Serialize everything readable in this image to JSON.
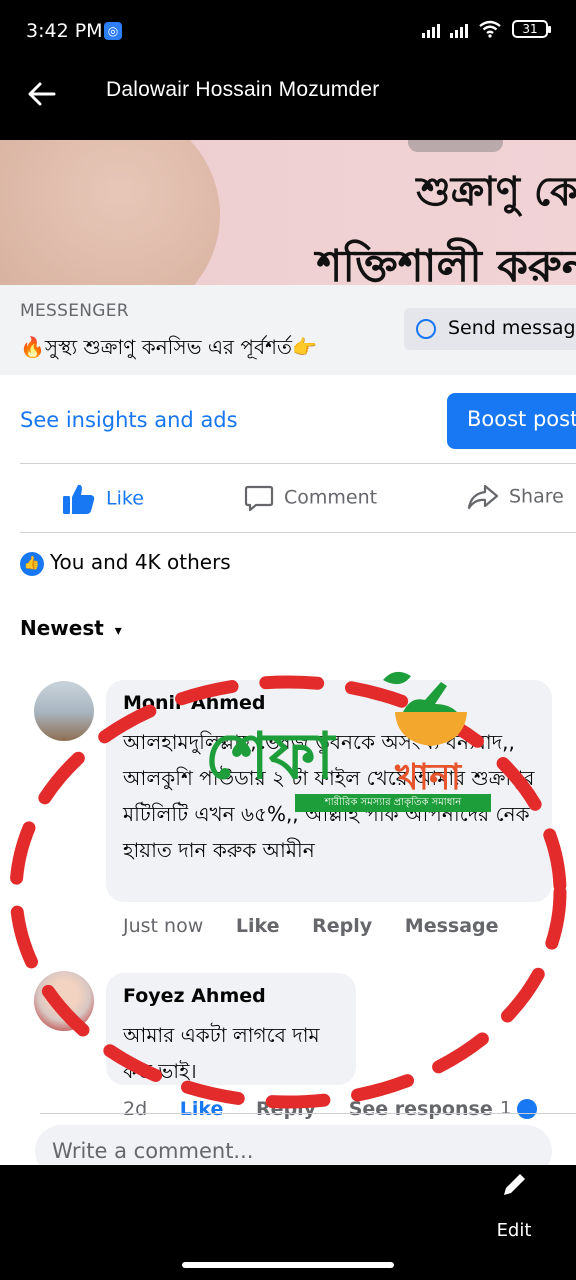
{
  "status_bar": {
    "time": "3:42 PM",
    "battery": "31"
  },
  "top_bar": {
    "title": "Dalowair Hossain Mozumder"
  },
  "post": {
    "banner_line1": "শুক্রাণু কে",
    "banner_line2": "শক্তিশালী করুন",
    "messenger_label": "MESSENGER",
    "messenger_text": "🔥সুস্থ্য শুক্রাণু কনসিভ এর পূর্বশর্ত👉",
    "send_message_label": "Send message",
    "insights_label": "See insights and ads",
    "boost_label": "Boost post"
  },
  "actions": {
    "like": "Like",
    "comment": "Comment",
    "share": "Share"
  },
  "reactions_text": "You and 4K others",
  "sort_label": "Newest",
  "comments": [
    {
      "name": "Monir Ahmed",
      "text": "আলহামদুলিল্লাহ,ভেষজ ভুবনকে অসংখ্য ধন্যবাদ,, আলকুশি পাউডার ২ টা ফাইল খেয়ে আমার শুক্রাণুর মটিলিটি এখন ৬৫%,, আল্লাহ পাক আপনাদের নেক হায়াত দান করুক আমীন",
      "time": "Just now",
      "like": "Like",
      "reply": "Reply",
      "message": "Message"
    },
    {
      "name": "Foyez Ahmed",
      "text": "আমার  একটা লাগবে দাম কত ভাই।",
      "time": "2d",
      "like": "Like",
      "reply": "Reply",
      "see_response": "See response",
      "reaction_count": "1"
    }
  ],
  "write_comment_placeholder": "Write a comment...",
  "logo": {
    "main": "শেফা",
    "second": "খানা",
    "tagline": "শারীরিক সমস্যার প্রাকৃতিক সমাধান"
  },
  "bottom": {
    "edit_label": "Edit"
  },
  "colors": {
    "accent": "#1877f2",
    "annotation_red": "#e32b2b",
    "logo_green": "#1e9e3a",
    "logo_orange": "#e8542c"
  }
}
